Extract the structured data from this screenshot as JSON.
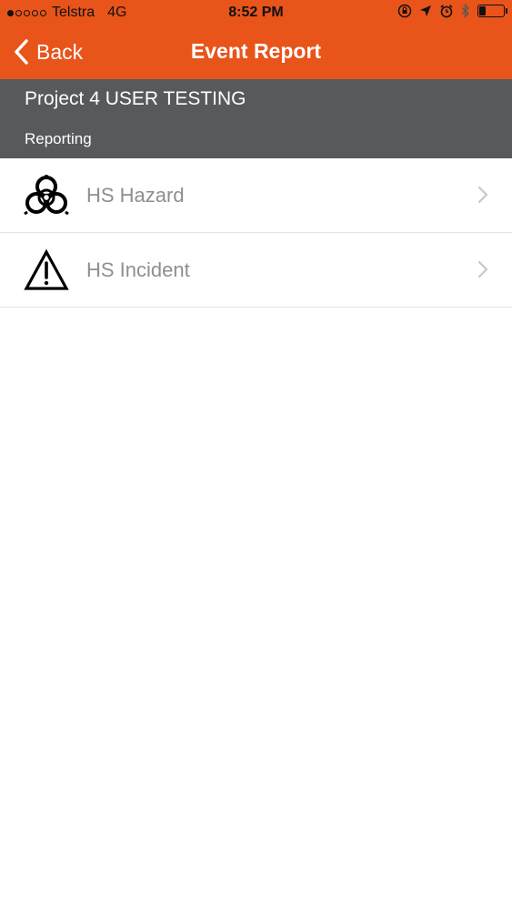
{
  "status_bar": {
    "signal_bars": 1,
    "carrier": "Telstra",
    "network": "4G",
    "time": "8:52 PM",
    "battery_level": 0.25
  },
  "nav": {
    "back_label": "Back",
    "title": "Event Report"
  },
  "project": {
    "title": "Project 4 USER TESTING",
    "subtitle": "Reporting"
  },
  "items": [
    {
      "label": "HS Hazard",
      "icon": "biohazard-icon"
    },
    {
      "label": "HS Incident",
      "icon": "warning-triangle-icon"
    }
  ],
  "colors": {
    "accent": "#e8541a",
    "header_gray": "#58595b",
    "item_text": "#8e8e93"
  }
}
